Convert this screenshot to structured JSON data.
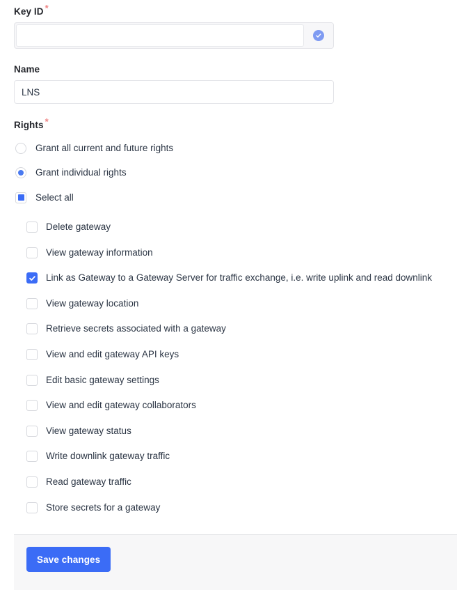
{
  "form": {
    "key_id": {
      "label": "Key ID",
      "required_marker": "*",
      "value": "",
      "placeholder": "",
      "copy_icon": "check-circle-icon"
    },
    "name": {
      "label": "Name",
      "value": "LNS",
      "placeholder": ""
    },
    "rights": {
      "label": "Rights",
      "required_marker": "*",
      "options": [
        {
          "label": "Grant all current and future rights",
          "selected": false
        },
        {
          "label": "Grant individual rights",
          "selected": true
        }
      ],
      "select_all": {
        "label": "Select all",
        "state": "indeterminate"
      },
      "items": [
        {
          "label": "Delete gateway",
          "checked": false
        },
        {
          "label": "View gateway information",
          "checked": false
        },
        {
          "label": "Link as Gateway to a Gateway Server for traffic exchange, i.e. write uplink and read downlink",
          "checked": true
        },
        {
          "label": "View gateway location",
          "checked": false
        },
        {
          "label": "Retrieve secrets associated with a gateway",
          "checked": false
        },
        {
          "label": "View and edit gateway API keys",
          "checked": false
        },
        {
          "label": "Edit basic gateway settings",
          "checked": false
        },
        {
          "label": "View and edit gateway collaborators",
          "checked": false
        },
        {
          "label": "View gateway status",
          "checked": false
        },
        {
          "label": "Write downlink gateway traffic",
          "checked": false
        },
        {
          "label": "Read gateway traffic",
          "checked": false
        },
        {
          "label": "Store secrets for a gateway",
          "checked": false
        }
      ]
    }
  },
  "footer": {
    "save_label": "Save changes"
  },
  "colors": {
    "accent": "#3b6cf6",
    "radio_accent": "#4a7af0",
    "required": "#ef8585",
    "text": "#2b3544",
    "label": "#25272d",
    "footer_bg": "#f7f7f8",
    "border": "#e3e4e8"
  }
}
